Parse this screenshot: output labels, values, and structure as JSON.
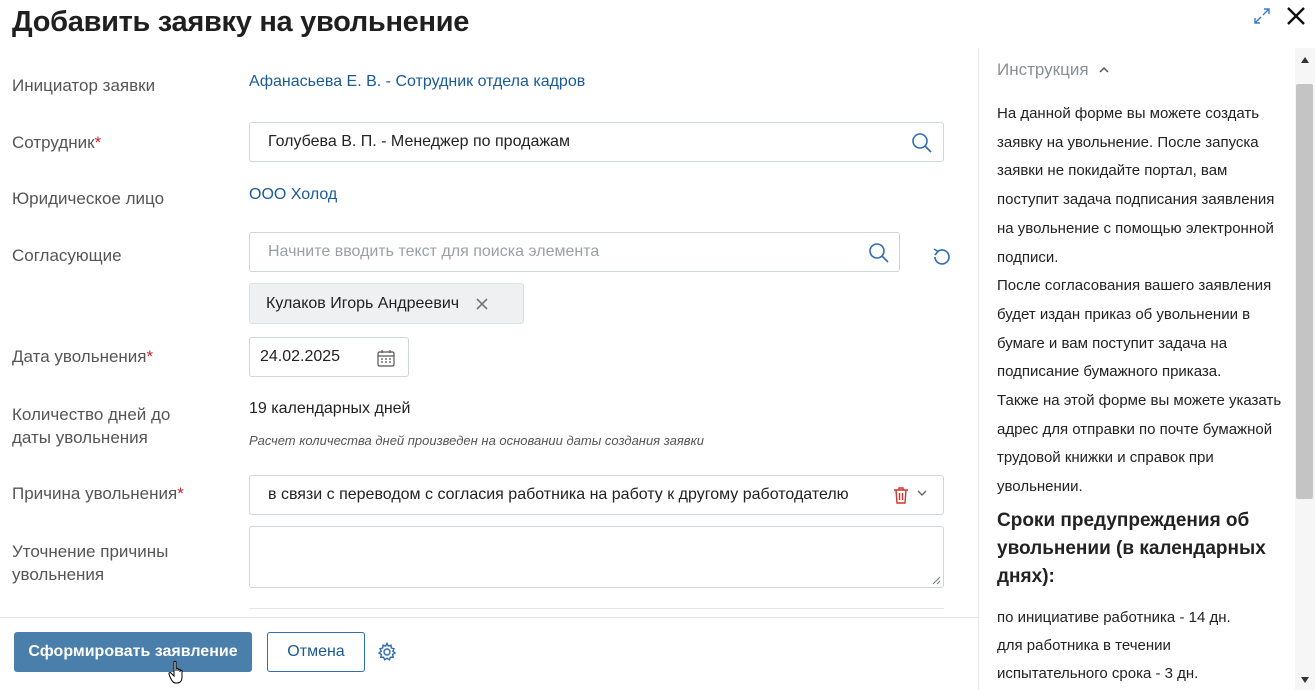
{
  "header": {
    "title": "Добавить заявку на увольнение"
  },
  "form": {
    "initiator": {
      "label": "Инициатор заявки",
      "value": "Афанасьева Е. В. - Сотрудник отдела кадров"
    },
    "employee": {
      "label": "Сотрудник",
      "required_mark": "*",
      "value": "Голубева В. П. - Менеджер по продажам"
    },
    "legal_entity": {
      "label": "Юридическое лицо",
      "value": "ООО Холод"
    },
    "approvers": {
      "label": "Согласующие",
      "placeholder": "Начните вводить текст для поиска элемента",
      "chip": "Кулаков Игорь Андреевич"
    },
    "dismissal_date": {
      "label": "Дата увольнения",
      "required_mark": "*",
      "value": "24.02.2025"
    },
    "days_count": {
      "label_line1": "Количество дней до",
      "label_line2": "даты увольнения",
      "value": "19 календарных дней",
      "hint": "Расчет количества дней произведен на основании даты создания заявки"
    },
    "reason": {
      "label": "Причина увольнения",
      "required_mark": "*",
      "value": "в связи с переводом с согласия работника на работу к другому работодателю"
    },
    "reason_details": {
      "label_line1": "Уточнение причины",
      "label_line2": "увольнения",
      "value": ""
    }
  },
  "footer": {
    "submit_label": "Сформировать заявление",
    "cancel_label": "Отмена"
  },
  "instruction": {
    "header": "Инструкция",
    "paragraph1": "На данной форме вы можете создать заявку на увольнение. После запуска заявки не покидайте портал, вам поступит задача подписания заявления на увольнение с помощью электронной подписи.",
    "paragraph2": "После согласования вашего заявления будет издан приказ об увольнении в бумаге и вам поступит задача на подписание бумажного приказа.",
    "paragraph3": "Также на этой форме вы можете указать адрес для отправки по почте бумажной трудовой книжки и справок при увольнении.",
    "subheading": "Сроки предупреждения об увольнении (в календарных днях):",
    "term1": "по инициативе работника - 14 дн.",
    "term2": "для работника в течении испытательного срока - 3 дн."
  },
  "colors": {
    "accent": "#2e6db0",
    "primary_button": "#4a7eab",
    "required": "#c0262c",
    "delete": "#d4332f"
  }
}
